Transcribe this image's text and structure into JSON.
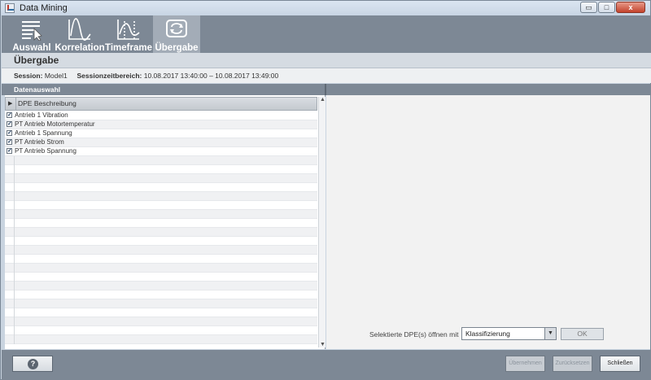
{
  "window": {
    "title": "Data Mining",
    "controls": [
      "▭",
      "□",
      "x"
    ]
  },
  "toolbar": {
    "items": [
      {
        "label": "Auswahl",
        "icon": "selection-list-icon"
      },
      {
        "label": "Korrelation",
        "icon": "correlation-curve-icon"
      },
      {
        "label": "Timeframe",
        "icon": "timeframe-chart-icon"
      },
      {
        "label": "Übergabe",
        "icon": "transfer-icon",
        "active": true
      }
    ]
  },
  "section": {
    "title": "Übergabe"
  },
  "session": {
    "session_label": "Session:",
    "session_value": "Model1",
    "range_label": "Sessionzeitbereich:",
    "range_value": "10.08.2017 13:40:00 – 10.08.2017 13:49:00"
  },
  "panels": {
    "left_title": "Datenauswahl"
  },
  "table": {
    "column_header": "DPE Beschreibung",
    "rows": [
      {
        "label": "Antrieb 1 Vibration",
        "checked": true
      },
      {
        "label": "PT Antrieb Motortemperatur",
        "checked": true
      },
      {
        "label": "Antrieb 1 Spannung",
        "checked": true
      },
      {
        "label": "PT Antrieb Strom",
        "checked": true
      },
      {
        "label": "PT Antrieb Spannung",
        "checked": true
      }
    ],
    "empty_rows": 21
  },
  "open_dialog": {
    "label": "Selektierte DPE(s) öffnen mit",
    "selected": "Klassifizierung",
    "ok_label": "OK"
  },
  "footer": {
    "help_label": "?",
    "apply_label": "Übernehmen",
    "reset_label": "Zurücksetzen",
    "close_label": "Schließen"
  }
}
